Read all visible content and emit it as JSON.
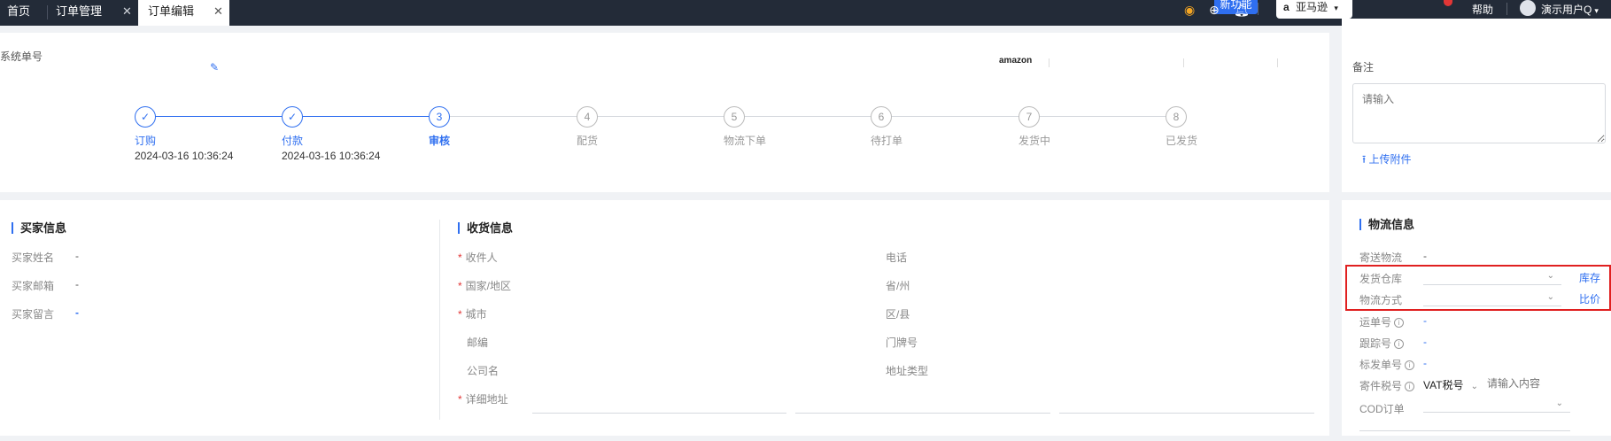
{
  "tabs": [
    {
      "label": "首页"
    },
    {
      "label": "订单管理"
    },
    {
      "label": "订单编辑"
    }
  ],
  "topbar": {
    "new_feature": "新功能",
    "platform": "亚马逊",
    "help": "帮助",
    "user": "演示用户Q"
  },
  "order": {
    "system_no_label": "系统单号",
    "platform_logo": "amazon"
  },
  "steps": [
    {
      "num": "1",
      "label": "订购",
      "time": "2024-03-16 10:36:24",
      "state": "done"
    },
    {
      "num": "2",
      "label": "付款",
      "time": "2024-03-16 10:36:24",
      "state": "done"
    },
    {
      "num": "3",
      "label": "审核",
      "time": "",
      "state": "current"
    },
    {
      "num": "4",
      "label": "配货",
      "time": "",
      "state": "todo"
    },
    {
      "num": "5",
      "label": "物流下单",
      "time": "",
      "state": "todo"
    },
    {
      "num": "6",
      "label": "待打单",
      "time": "",
      "state": "todo"
    },
    {
      "num": "7",
      "label": "发货中",
      "time": "",
      "state": "todo"
    },
    {
      "num": "8",
      "label": "已发货",
      "time": "",
      "state": "todo"
    }
  ],
  "remark": {
    "title": "备注",
    "placeholder": "请输入",
    "upload": "上传附件"
  },
  "buyer": {
    "title": "买家信息",
    "fields": [
      {
        "label": "买家姓名",
        "value": "-"
      },
      {
        "label": "买家邮箱",
        "value": "-"
      },
      {
        "label": "买家留言",
        "value": "-"
      }
    ]
  },
  "shipping": {
    "title": "收货信息",
    "left": [
      {
        "label": "收件人",
        "required": true
      },
      {
        "label": "国家/地区",
        "required": true
      },
      {
        "label": "城市",
        "required": true
      },
      {
        "label": "邮编",
        "required": false
      },
      {
        "label": "公司名",
        "required": false
      },
      {
        "label": "详细地址",
        "required": true
      }
    ],
    "right": [
      {
        "label": "电话"
      },
      {
        "label": "省/州"
      },
      {
        "label": "区/县"
      },
      {
        "label": "门牌号"
      },
      {
        "label": "地址类型"
      }
    ]
  },
  "logistics": {
    "title": "物流信息",
    "carrier": {
      "label": "寄送物流",
      "value": "-"
    },
    "warehouse": {
      "label": "发货仓库",
      "link": "库存"
    },
    "method": {
      "label": "物流方式",
      "link": "比价"
    },
    "waybill": {
      "label": "运单号",
      "value": "-"
    },
    "tracking": {
      "label": "跟踪号",
      "value": "-"
    },
    "mark_no": {
      "label": "标发单号",
      "value": "-"
    },
    "tax": {
      "label": "寄件税号",
      "type": "VAT税号",
      "placeholder": "请输入内容"
    },
    "cod": {
      "label": "COD订单"
    }
  },
  "colors": {
    "accent": "#2f6ff0",
    "topbar": "#232b38",
    "highlight": "#e02020"
  }
}
